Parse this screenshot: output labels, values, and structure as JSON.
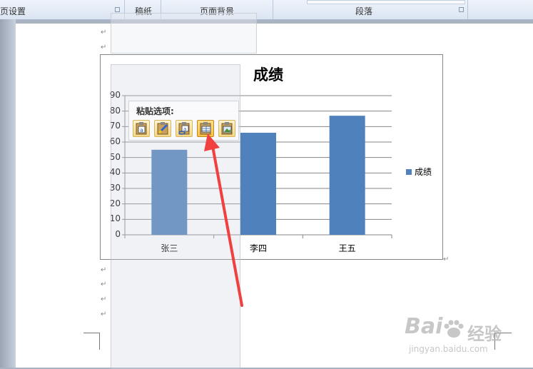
{
  "ribbon": {
    "groups": [
      "页设置",
      "稿纸",
      "页面背景",
      "段落"
    ]
  },
  "chart_data": {
    "type": "bar",
    "title": "成绩",
    "categories": [
      "张三",
      "李四",
      "王五"
    ],
    "series": [
      {
        "name": "成绩",
        "values": [
          55,
          66,
          77
        ]
      }
    ],
    "ylim": [
      0,
      90
    ],
    "yticks": [
      "0",
      "10",
      "20",
      "30",
      "40",
      "50",
      "60",
      "70",
      "80",
      "90"
    ],
    "grid": true,
    "legend_position": "right",
    "bar_color": "#4f81bd"
  },
  "paste_options": {
    "title": "粘贴选项:",
    "icons": [
      "paste-keep-source-icon",
      "paste-merge-format-icon",
      "paste-link-icon",
      "paste-embed-workbook-icon",
      "paste-picture-icon"
    ],
    "active_index": 3
  },
  "watermark": {
    "brand": "Bai",
    "brand2": "经验",
    "url": "jingyan.baidu.com"
  },
  "colors": {
    "arrow": "#f04040",
    "bar": "#4f81bd"
  }
}
